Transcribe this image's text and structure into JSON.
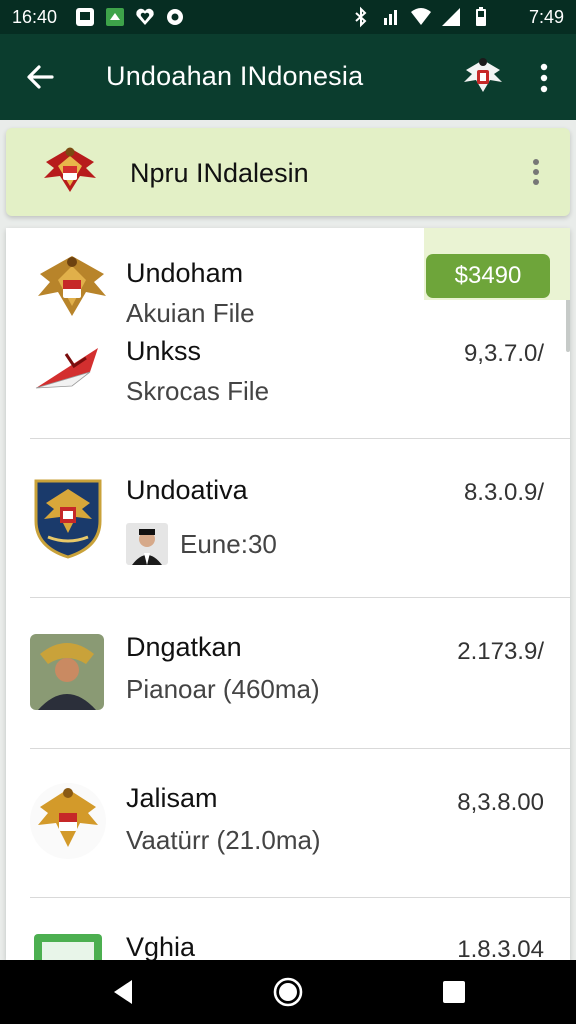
{
  "status_bar": {
    "time_left": "16:40",
    "time_right": "7:49",
    "icons_left": [
      "image-icon",
      "app-notification-icon",
      "heart-icon",
      "app-icon"
    ],
    "icons_right": [
      "bluetooth-icon",
      "signal-icon",
      "wifi-icon",
      "cell-signal-icon",
      "battery-icon"
    ]
  },
  "app_bar": {
    "title": "Undoahan INdonesia",
    "back_icon": "arrow-left-icon",
    "emblem_icon": "garuda-emblem-icon",
    "menu_icon": "more-vertical-icon"
  },
  "banner": {
    "title": "Npru INdalesin",
    "emblem_icon": "garuda-emblem-icon",
    "menu_icon": "more-vertical-icon"
  },
  "list": {
    "items": [
      {
        "name": "Undoham",
        "sub": "Akuian File",
        "badge": "$3490",
        "icon": "garuda-emblem-icon"
      },
      {
        "name": "Unkss",
        "sub": "Skrocas File",
        "value": "9,3.7.0/",
        "icon": "red-flag-icon"
      },
      {
        "name": "Undoativa",
        "sub": "Eune:30",
        "value": "8.3.0.9/",
        "icon": "coat-of-arms-icon",
        "sub_icon": "person-avatar-icon"
      },
      {
        "name": "Dngatkan",
        "sub": "Pianoar (460ma)",
        "value": "2.173.9/",
        "icon": "portrait-icon"
      },
      {
        "name": "Jalisam",
        "sub": "Vaatürr (21.0ma)",
        "value": "8,3.8.00",
        "icon": "garuda-emblem-icon"
      },
      {
        "name": "Vghia",
        "value": "1.8.3.04",
        "icon": "green-app-icon"
      }
    ]
  },
  "nav_bar": {
    "back_icon": "nav-back-icon",
    "home_icon": "nav-home-icon",
    "recents_icon": "nav-recents-icon"
  },
  "colors": {
    "status_bar": "#062d22",
    "app_bar": "#0b3d2e",
    "banner": "#e3f0c6",
    "badge": "#6ea53a"
  }
}
